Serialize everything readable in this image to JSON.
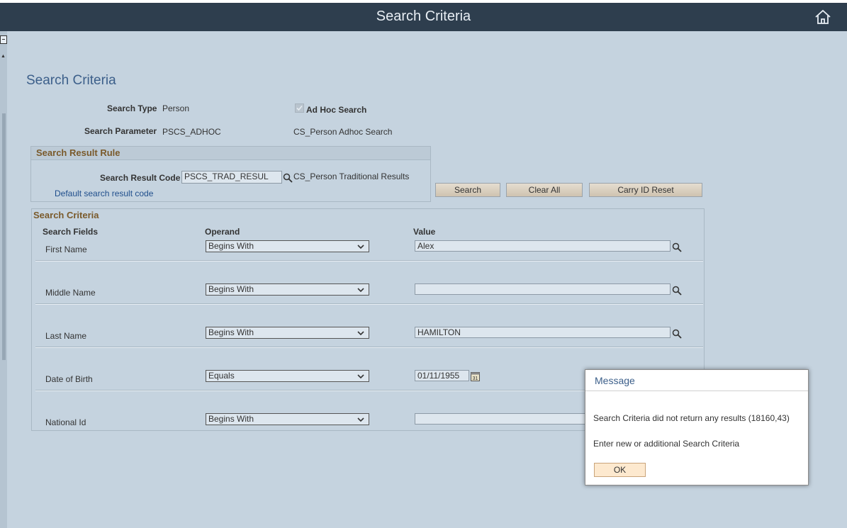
{
  "header": {
    "title": "Search Criteria",
    "home_icon": "home-icon"
  },
  "page": {
    "title": "Search Criteria",
    "search_type_label": "Search Type",
    "search_type_value": "Person",
    "ad_hoc_label": "Ad Hoc Search",
    "ad_hoc_checked": true,
    "search_param_label": "Search Parameter",
    "search_param_value": "PSCS_ADHOC",
    "search_param_desc": "CS_Person Adhoc Search"
  },
  "result_rule": {
    "heading": "Search Result Rule",
    "code_label": "Search Result Code",
    "code_value": "PSCS_TRAD_RESUL",
    "code_desc": "CS_Person Traditional Results",
    "default_link": "Default search result code"
  },
  "buttons": {
    "search": "Search",
    "clear_all": "Clear All",
    "carry_id_reset": "Carry ID Reset"
  },
  "criteria": {
    "heading": "Search Criteria",
    "col_fields": "Search Fields",
    "col_operand": "Operand",
    "col_value": "Value",
    "rows": [
      {
        "field": "First Name",
        "operand": "Begins With",
        "value": "Alex"
      },
      {
        "field": "Middle Name",
        "operand": "Begins With",
        "value": ""
      },
      {
        "field": "Last Name",
        "operand": "Begins With",
        "value": "HAMILTON"
      },
      {
        "field": "Date of Birth",
        "operand": "Equals",
        "value": "01/11/1955"
      },
      {
        "field": "National Id",
        "operand": "Begins With",
        "value": ""
      }
    ]
  },
  "message": {
    "title": "Message",
    "line1": "Search Criteria did not return any results (18160,43)",
    "line2": "Enter new or additional Search Criteria",
    "ok": "OK"
  }
}
